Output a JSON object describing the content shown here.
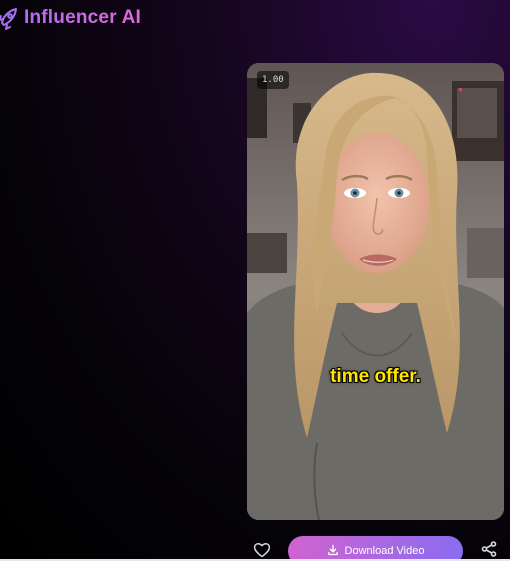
{
  "header": {
    "title": "Influencer AI",
    "logo_icon": "rocket-icon"
  },
  "video": {
    "speed_label": "1.00",
    "caption": "time offer.",
    "accent_colors": {
      "caption": "#ffe600"
    }
  },
  "actions": {
    "like_icon": "heart-icon",
    "download_label": "Download Video",
    "download_icon": "download-icon",
    "share_icon": "share-icon"
  },
  "colors": {
    "brand_gradient_start": "#b56cf7",
    "brand_gradient_end": "#e06ad6",
    "button_gradient_start": "#d063cf",
    "button_gradient_end": "#8a6cf0"
  }
}
